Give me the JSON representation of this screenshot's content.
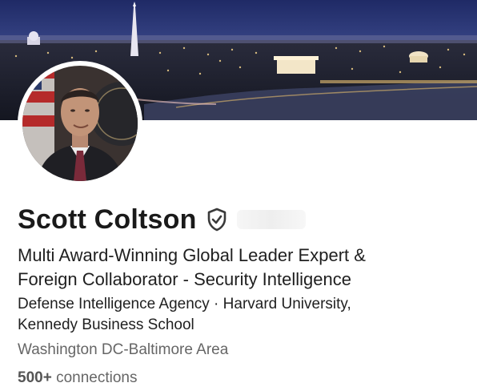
{
  "profile": {
    "name": "Scott Coltson",
    "headline_line1": "Multi Award-Winning Global Leader Expert &",
    "headline_line2": "Foreign Collaborator - Security Intelligence",
    "company_line1": "Defense Intelligence Agency · Harvard University,",
    "company_line2": "Kennedy Business School",
    "location": "Washington DC-Baltimore Area",
    "connections_count": "500+",
    "connections_label": "connections"
  },
  "icons": {
    "verified": "verified-shield-icon"
  },
  "colors": {
    "text_primary": "#1a1a1a",
    "text_secondary": "#666666",
    "banner_sky": "#2b3a78"
  }
}
